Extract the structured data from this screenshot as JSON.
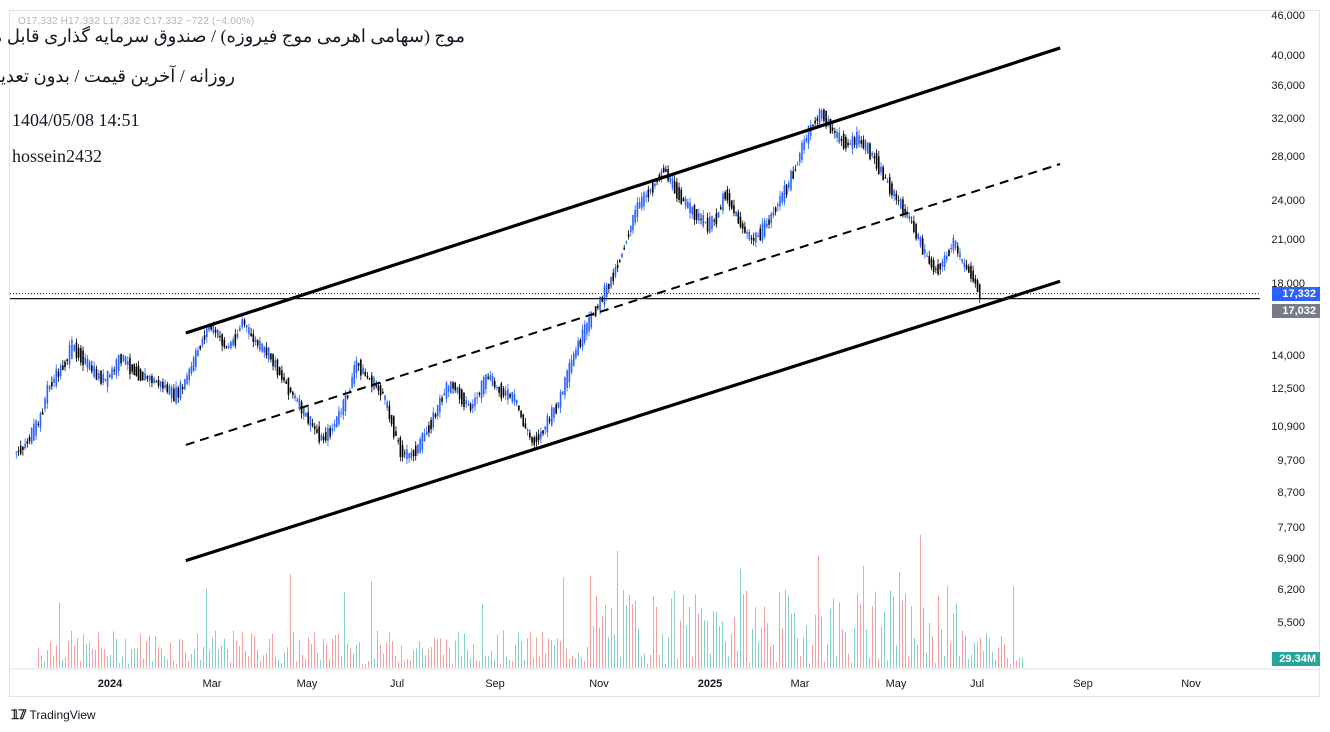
{
  "header": {
    "symbol_title": "موج (سهامی اهرمی موج فیروزه) / صندوق سرمایه گذاری قابل معامله",
    "subtitle": "روزانه / آخرین قیمت / بدون تعدیل",
    "datetime": "1404/05/08 14:51",
    "author": "hossein2432",
    "ohlc_line": "O17,332  H17,332  L17,332  C17,332  −722 (−4.00%)"
  },
  "price_axis": {
    "ticks": [
      "46,000",
      "40,000",
      "36,000",
      "32,000",
      "28,000",
      "24,000",
      "21,000",
      "18,000",
      "14,000",
      "12,500",
      "10,900",
      "9,700",
      "8,700",
      "7,700",
      "6,900",
      "6,200",
      "5,500"
    ],
    "last_price_label": "17,332",
    "last_price_color": "#2962ff",
    "prev_close_label": "17,032",
    "prev_close_color": "#787b86",
    "volume_label": "29.34M",
    "volume_color": "#26a69a"
  },
  "time_axis": {
    "labels": [
      "2024",
      "Mar",
      "May",
      "Jul",
      "Sep",
      "Nov",
      "2025",
      "Mar",
      "May",
      "Jul",
      "Sep",
      "Nov"
    ],
    "bold": [
      "2024",
      "2025"
    ]
  },
  "branding": {
    "logo_text": "TradingView"
  },
  "colors": {
    "up_candle": "#2962ff",
    "down_candle": "#000000",
    "vol_up": "#26a69a",
    "vol_down": "#ef5350"
  },
  "chart_data": {
    "type": "candlestick",
    "title": "موج (سهامی اهرمی موج فیروزه) / صندوق سرمایه گذاری قابل معامله",
    "scale": "log",
    "ylim": [
      5000,
      46000
    ],
    "x_range": [
      "2023-12-18",
      "2025-11-25"
    ],
    "close_series": [
      [
        "2023-12-20",
        9900
      ],
      [
        "2023-12-25",
        10100
      ],
      [
        "2023-12-30",
        10600
      ],
      [
        "2024-01-04",
        11200
      ],
      [
        "2024-01-08",
        12400
      ],
      [
        "2024-01-13",
        13000
      ],
      [
        "2024-01-18",
        13600
      ],
      [
        "2024-01-22",
        14400
      ],
      [
        "2024-01-27",
        13900
      ],
      [
        "2024-02-01",
        13400
      ],
      [
        "2024-02-05",
        13000
      ],
      [
        "2024-02-10",
        12800
      ],
      [
        "2024-02-15",
        13300
      ],
      [
        "2024-02-19",
        13900
      ],
      [
        "2024-02-24",
        13400
      ],
      [
        "2024-03-01",
        13000
      ],
      [
        "2024-03-05",
        12900
      ],
      [
        "2024-03-10",
        12700
      ],
      [
        "2024-03-15",
        12500
      ],
      [
        "2024-03-20",
        12100
      ],
      [
        "2024-03-25",
        12500
      ],
      [
        "2024-03-30",
        13400
      ],
      [
        "2024-04-04",
        14500
      ],
      [
        "2024-04-09",
        15500
      ],
      [
        "2024-04-14",
        15000
      ],
      [
        "2024-04-19",
        14300
      ],
      [
        "2024-04-24",
        14800
      ],
      [
        "2024-04-28",
        15800
      ],
      [
        "2024-05-03",
        14900
      ],
      [
        "2024-05-08",
        14400
      ],
      [
        "2024-05-13",
        14000
      ],
      [
        "2024-05-18",
        13300
      ],
      [
        "2024-05-23",
        12600
      ],
      [
        "2024-05-28",
        12000
      ],
      [
        "2024-06-02",
        11400
      ],
      [
        "2024-06-07",
        10900
      ],
      [
        "2024-06-12",
        10400
      ],
      [
        "2024-06-17",
        10700
      ],
      [
        "2024-06-22",
        11300
      ],
      [
        "2024-06-27",
        12200
      ],
      [
        "2024-07-02",
        13600
      ],
      [
        "2024-07-07",
        13000
      ],
      [
        "2024-07-12",
        12600
      ],
      [
        "2024-07-17",
        12200
      ],
      [
        "2024-07-22",
        11000
      ],
      [
        "2024-07-27",
        10000
      ],
      [
        "2024-08-01",
        9800
      ],
      [
        "2024-08-06",
        10100
      ],
      [
        "2024-08-11",
        10700
      ],
      [
        "2024-08-16",
        11400
      ],
      [
        "2024-08-21",
        12300
      ],
      [
        "2024-08-26",
        12600
      ],
      [
        "2024-08-31",
        12000
      ],
      [
        "2024-09-05",
        11600
      ],
      [
        "2024-09-10",
        12300
      ],
      [
        "2024-09-15",
        13000
      ],
      [
        "2024-09-20",
        12400
      ],
      [
        "2024-09-25",
        12200
      ],
      [
        "2024-09-30",
        12000
      ],
      [
        "2024-10-05",
        11000
      ],
      [
        "2024-10-10",
        10300
      ],
      [
        "2024-10-15",
        10600
      ],
      [
        "2024-10-20",
        11200
      ],
      [
        "2024-10-25",
        11800
      ],
      [
        "2024-10-30",
        13000
      ],
      [
        "2024-11-04",
        14200
      ],
      [
        "2024-11-09",
        15200
      ],
      [
        "2024-11-14",
        16200
      ],
      [
        "2024-11-19",
        17100
      ],
      [
        "2024-11-24",
        18200
      ],
      [
        "2024-11-29",
        19600
      ],
      [
        "2024-12-04",
        21500
      ],
      [
        "2024-12-09",
        23500
      ],
      [
        "2024-12-14",
        24500
      ],
      [
        "2024-12-19",
        25500
      ],
      [
        "2024-12-24",
        26900
      ],
      [
        "2024-12-29",
        25300
      ],
      [
        "2025-01-03",
        24200
      ],
      [
        "2025-01-08",
        23300
      ],
      [
        "2025-01-13",
        22600
      ],
      [
        "2025-01-18",
        22000
      ],
      [
        "2025-01-23",
        22600
      ],
      [
        "2025-01-28",
        24700
      ],
      [
        "2025-02-02",
        23100
      ],
      [
        "2025-02-07",
        21800
      ],
      [
        "2025-02-12",
        20900
      ],
      [
        "2025-02-17",
        21400
      ],
      [
        "2025-02-22",
        22400
      ],
      [
        "2025-02-27",
        23800
      ],
      [
        "2025-03-04",
        25100
      ],
      [
        "2025-03-09",
        27000
      ],
      [
        "2025-03-14",
        29500
      ],
      [
        "2025-03-19",
        31500
      ],
      [
        "2025-03-24",
        32600
      ],
      [
        "2025-03-29",
        31000
      ],
      [
        "2025-04-03",
        29800
      ],
      [
        "2025-04-08",
        29200
      ],
      [
        "2025-04-13",
        29800
      ],
      [
        "2025-04-18",
        29000
      ],
      [
        "2025-04-23",
        27800
      ],
      [
        "2025-04-28",
        26200
      ],
      [
        "2025-05-03",
        24800
      ],
      [
        "2025-05-08",
        23600
      ],
      [
        "2025-05-13",
        22500
      ],
      [
        "2025-05-18",
        21000
      ],
      [
        "2025-05-23",
        19600
      ],
      [
        "2025-05-28",
        18800
      ],
      [
        "2025-06-02",
        19500
      ],
      [
        "2025-06-07",
        20800
      ],
      [
        "2025-06-12",
        19300
      ],
      [
        "2025-06-17",
        18600
      ],
      [
        "2025-06-22",
        17332
      ]
    ],
    "channel": {
      "upper": [
        [
          "2024-03-26",
          15100
        ],
        [
          "2025-08-06",
          41000
        ]
      ],
      "middle": [
        [
          "2024-03-26",
          10200
        ],
        [
          "2025-08-06",
          27300
        ]
      ],
      "lower": [
        [
          "2024-03-26",
          6800
        ],
        [
          "2025-08-06",
          18100
        ]
      ]
    },
    "horizontal_lines": [
      17332,
      17032
    ],
    "volume_last": "29.34M"
  }
}
